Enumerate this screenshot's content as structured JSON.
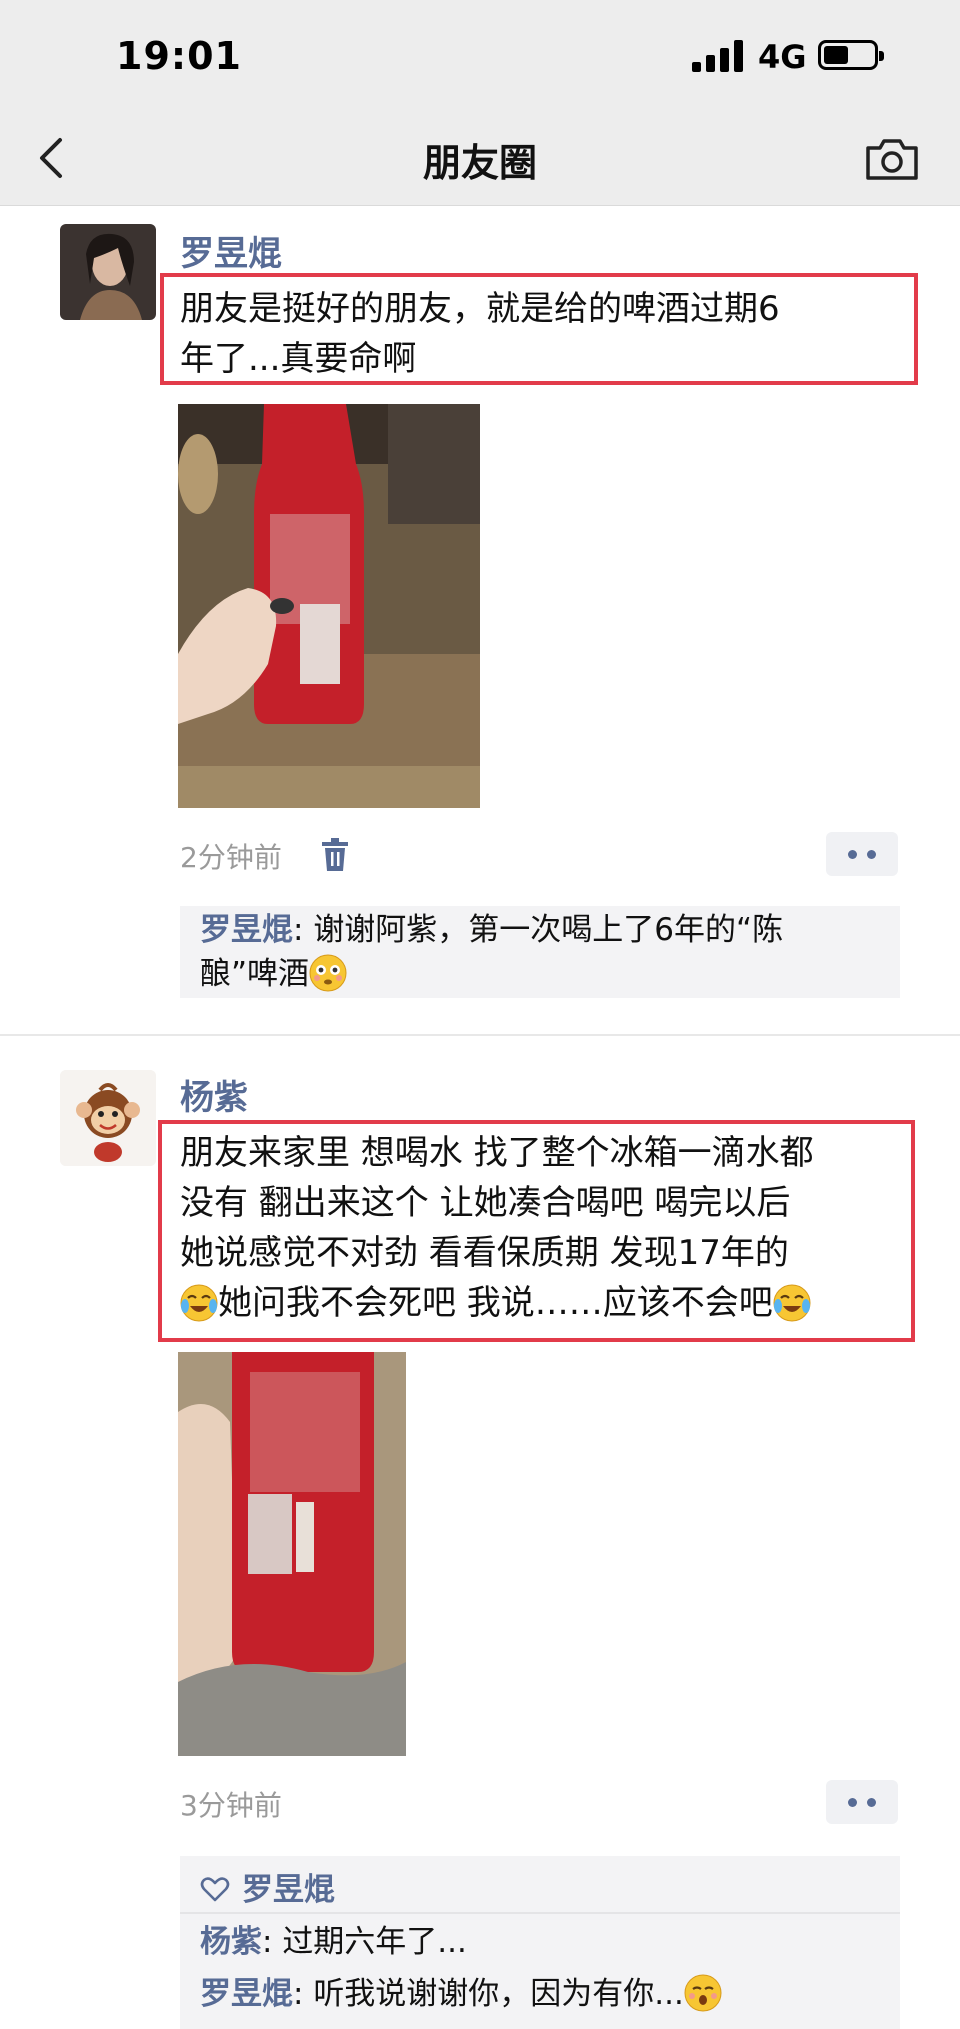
{
  "status_bar": {
    "time": "19:01",
    "network": "4G"
  },
  "nav": {
    "title": "朋友圈"
  },
  "posts": [
    {
      "author": "罗昱焜",
      "text_line1": "朋友是挺好的朋友，就是给的啤酒过期6",
      "text_line2": "年了...真要命啊",
      "timestamp": "2分钟前",
      "comments": [
        {
          "name": "罗昱焜",
          "sep": ": ",
          "text_line1": "谢谢阿紫，第一次喝上了6年的“陈",
          "text_line2": "酿”啤酒"
        }
      ]
    },
    {
      "author": "杨紫",
      "text_lines": [
        "朋友来家里 想喝水 找了整个冰箱一滴水都",
        "没有 翻出来这个 让她凑合喝吧 喝完以后",
        "她说感觉不对劲 看看保质期 发现17年的",
        "她问我不会死吧 我说……应该不会吧"
      ],
      "timestamp": "3分钟前",
      "likes": "罗昱焜",
      "comments": [
        {
          "name": "杨紫",
          "sep": ": ",
          "text": "过期六年了..."
        },
        {
          "name": "罗昱焜",
          "sep": ": ",
          "text": "听我说谢谢你，因为有你..."
        }
      ]
    }
  ],
  "colors": {
    "accent": "#576b95",
    "highlight": "#e23b4a",
    "nav_bg": "#ededed"
  }
}
